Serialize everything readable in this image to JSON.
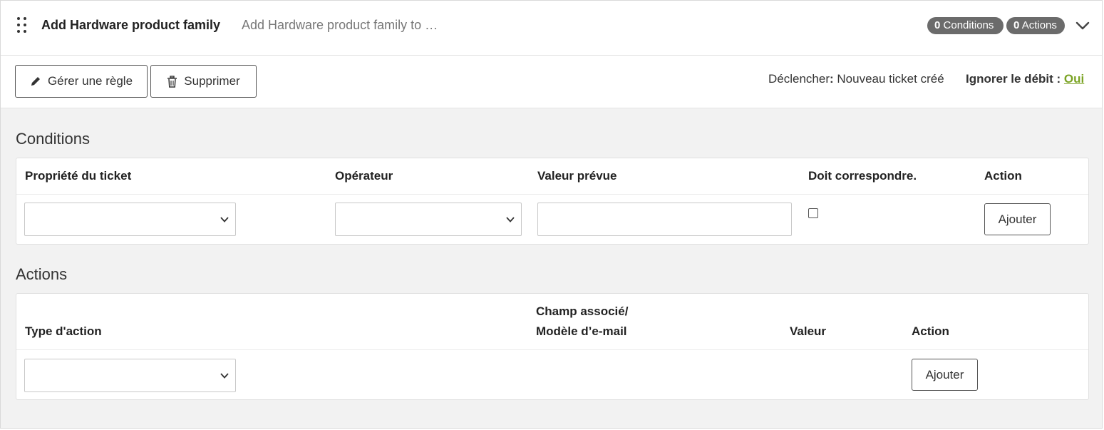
{
  "rule": {
    "title": "Add Hardware product family",
    "description": "Add Hardware product family to …",
    "conditions_count": "0",
    "conditions_label": "Conditions",
    "actions_count": "0",
    "actions_label": "Actions"
  },
  "toolbar": {
    "manage_label": "Gérer une règle",
    "delete_label": "Supprimer",
    "trigger_label": "Déclencher",
    "trigger_value": "Nouveau ticket créé",
    "ignore_debit_label": "Ignorer le débit :",
    "ignore_debit_value": "Oui"
  },
  "conditions": {
    "title": "Conditions",
    "headers": [
      "Propriété du ticket",
      "Opérateur",
      "Valeur prévue",
      "Doit correspondre.",
      "Action"
    ],
    "add_label": "Ajouter"
  },
  "actions": {
    "title": "Actions",
    "headers": {
      "type": "Type d'action",
      "field_line1": "Champ associé/",
      "field_line2": "Modèle d’e-mail",
      "value": "Valeur",
      "action": "Action"
    },
    "add_label": "Ajouter"
  },
  "icons": {
    "drag": "drag-handle-icon",
    "chevron": "chevron-down-icon",
    "pencil": "pencil-icon",
    "trash": "trash-icon"
  }
}
